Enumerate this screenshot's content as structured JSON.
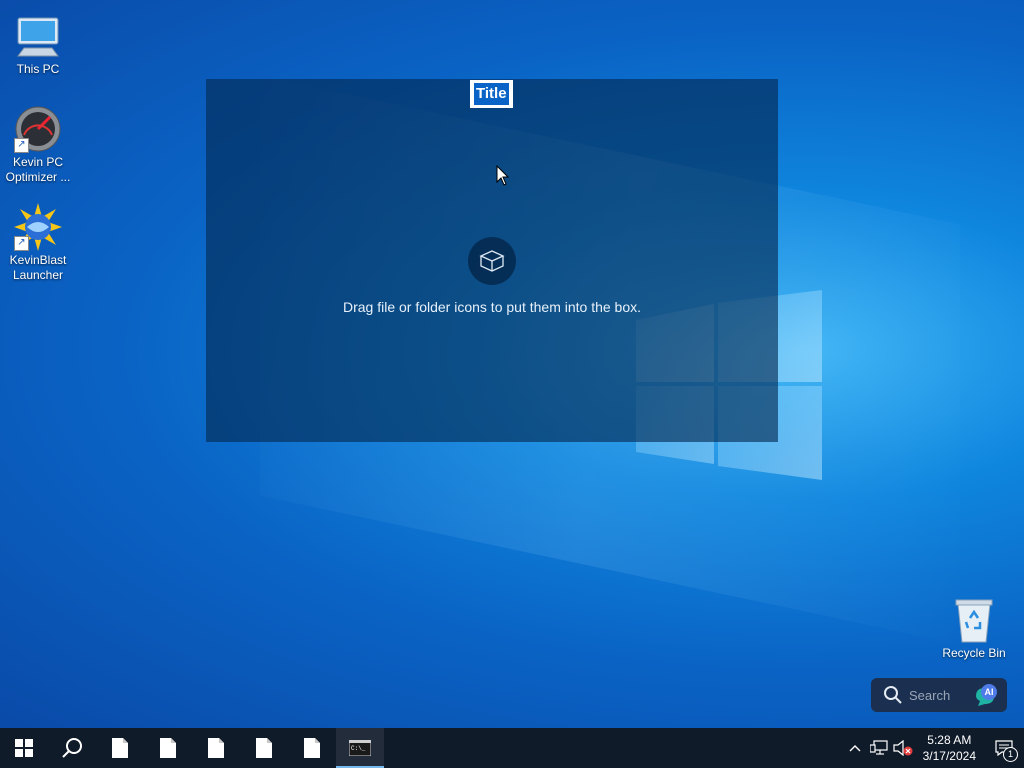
{
  "desktop": {
    "icons": [
      {
        "label": "This PC",
        "icon": "computer-icon"
      },
      {
        "label": "Kevin PC Optimizer ...",
        "icon": "speedometer-icon"
      },
      {
        "label": "KevinBlast Launcher",
        "icon": "globe-burst-icon"
      },
      {
        "label": "Recycle Bin",
        "icon": "recycle-bin-icon"
      }
    ]
  },
  "fence": {
    "title": "Title",
    "hint": "Drag file or folder icons to put them into the box.",
    "icon": "box-icon"
  },
  "search_widget": {
    "placeholder": "Search",
    "ai_label": "AI"
  },
  "taskbar": {
    "buttons": [
      {
        "name": "start",
        "icon": "windows-icon"
      },
      {
        "name": "search",
        "icon": "search-icon"
      },
      {
        "name": "file-1",
        "icon": "document-icon"
      },
      {
        "name": "file-2",
        "icon": "document-icon"
      },
      {
        "name": "file-3",
        "icon": "document-icon"
      },
      {
        "name": "file-4",
        "icon": "document-icon"
      },
      {
        "name": "file-5",
        "icon": "document-icon"
      },
      {
        "name": "terminal",
        "icon": "terminal-icon",
        "active": true
      }
    ],
    "tray": {
      "time": "5:28 AM",
      "date": "3/17/2024",
      "notification_count": "1"
    }
  },
  "colors": {
    "fence_bg": "#04285080",
    "accent": "#0a64c8",
    "taskbar": "#101b2a"
  }
}
